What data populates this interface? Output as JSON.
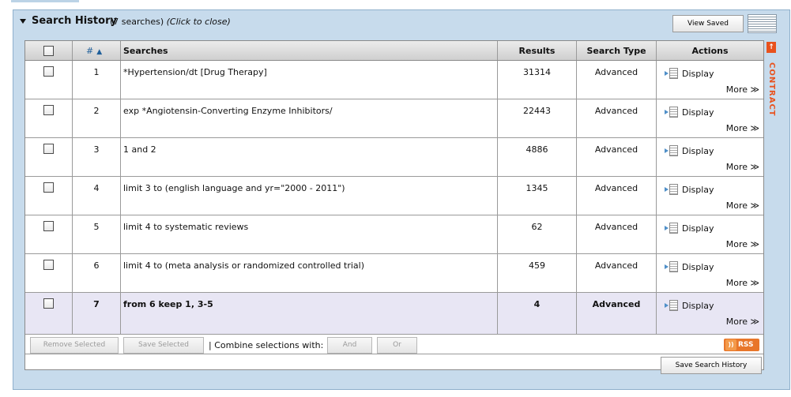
{
  "header": {
    "title": "Search History",
    "count": "(7 searches)",
    "close_hint": "(Click to close)",
    "view_saved": "View Saved"
  },
  "side_tab": {
    "label": "CONTRACT",
    "arrow": "↑"
  },
  "table": {
    "columns": {
      "number": "#",
      "sort_indicator": "▲",
      "searches": "Searches",
      "results": "Results",
      "search_type": "Search Type",
      "actions": "Actions"
    },
    "rows": [
      {
        "num": "1",
        "search": "*Hypertension/dt [Drug Therapy]",
        "results": "31314",
        "type": "Advanced",
        "display": "Display",
        "more": "More ≫"
      },
      {
        "num": "2",
        "search": "exp *Angiotensin-Converting Enzyme Inhibitors/",
        "results": "22443",
        "type": "Advanced",
        "display": "Display",
        "more": "More ≫"
      },
      {
        "num": "3",
        "search": "1 and 2",
        "results": "4886",
        "type": "Advanced",
        "display": "Display",
        "more": "More ≫"
      },
      {
        "num": "4",
        "search": "limit 3 to (english language and yr=\"2000 - 2011\")",
        "results": "1345",
        "type": "Advanced",
        "display": "Display",
        "more": "More ≫"
      },
      {
        "num": "5",
        "search": "limit 4 to systematic reviews",
        "results": "62",
        "type": "Advanced",
        "display": "Display",
        "more": "More ≫"
      },
      {
        "num": "6",
        "search": "limit 4 to (meta analysis or randomized controlled trial)",
        "results": "459",
        "type": "Advanced",
        "display": "Display",
        "more": "More ≫"
      },
      {
        "num": "7",
        "search": "from 6 keep 1, 3-5",
        "results": "4",
        "type": "Advanced",
        "display": "Display",
        "more": "More ≫"
      }
    ]
  },
  "footer": {
    "remove_selected": "Remove Selected",
    "save_selected": "Save Selected",
    "combine_label": "| Combine selections with:",
    "and": "And",
    "or": "Or",
    "rss": "RSS",
    "save_history": "Save Search History"
  },
  "colors": {
    "panel_bg": "#c7dbec",
    "accent_blue": "#1f5f9a",
    "contract_orange": "#e8521e",
    "rss_orange": "#e8762a",
    "highlight_row": "#e8e6f4"
  },
  "icons": {
    "collapse": "triangle-down-icon",
    "list_view": "list-view-icon",
    "display": "document-arrow-icon",
    "rss": "rss-feed-icon",
    "contract": "arrow-up-icon"
  }
}
